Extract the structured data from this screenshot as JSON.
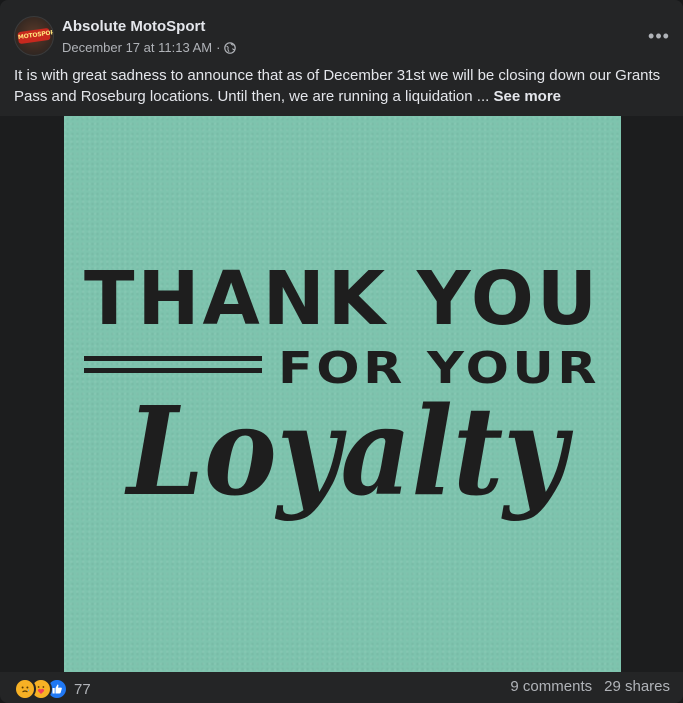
{
  "post": {
    "page_name": "Absolute MotoSport",
    "avatar_text": "MOTOSPORT",
    "timestamp": "December 17 at 11:13 AM",
    "separator": "·",
    "privacy_icon": "globe-icon",
    "more_label": "•••",
    "text": "It is with great sadness to announce that as of December 31st we will be closing down our Grants Pass and Roseburg locations. Until then, we are running a liquidation ...",
    "see_more": "See more"
  },
  "image": {
    "line1": "THANK YOU",
    "line2": "FOR YOUR",
    "line3": "Loyalty",
    "background_color": "#7ec4ae",
    "text_color": "#1e1e1e"
  },
  "footer": {
    "reactions": [
      "sad-icon",
      "care-icon",
      "like-icon"
    ],
    "reaction_count": "77",
    "comments": "9 comments",
    "shares": "29 shares"
  }
}
